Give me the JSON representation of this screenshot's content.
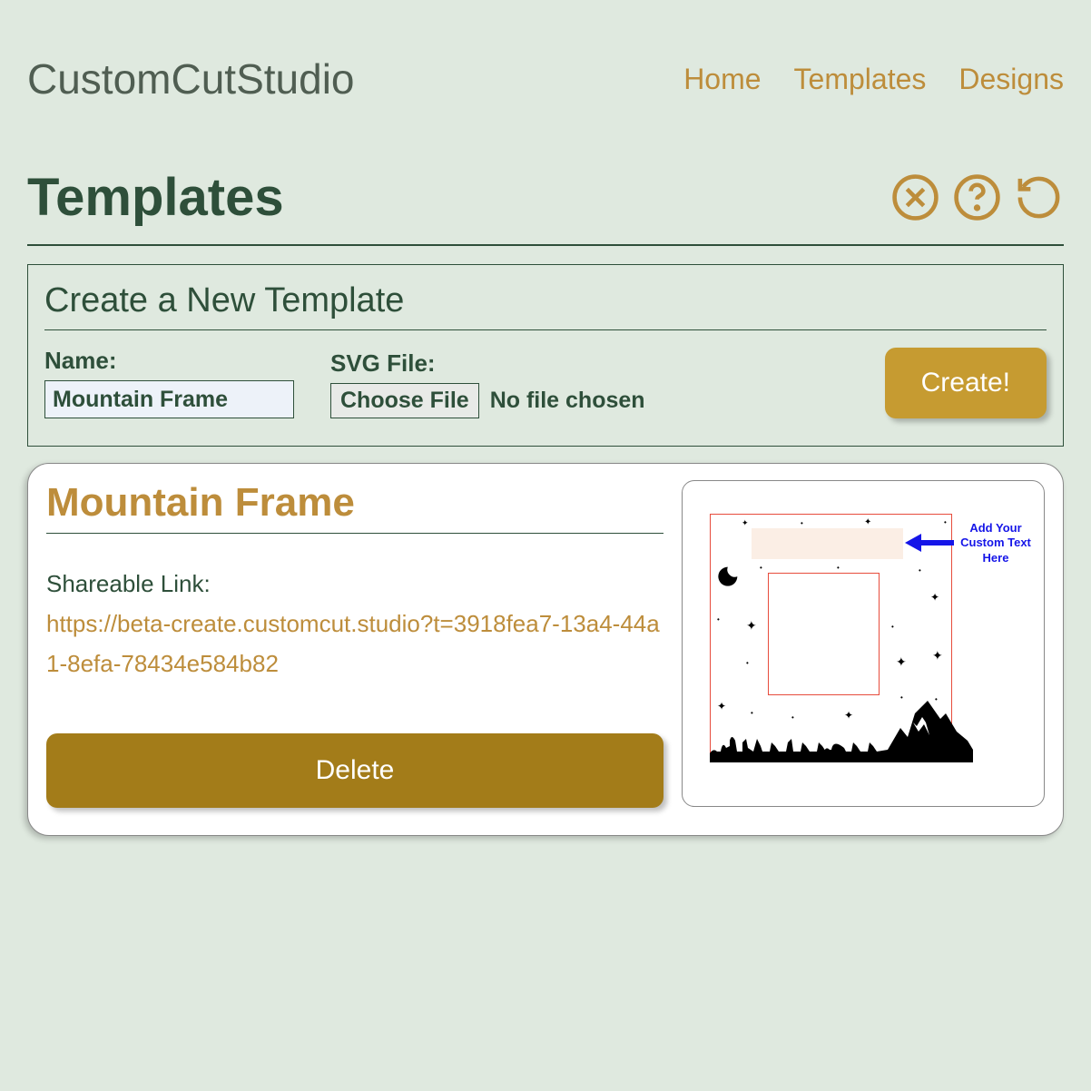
{
  "logo": "CustomCutStudio",
  "nav": {
    "home": "Home",
    "templates": "Templates",
    "designs": "Designs"
  },
  "page": {
    "title": "Templates"
  },
  "create": {
    "panel_title": "Create a New Template",
    "name_label": "Name:",
    "name_value": "Mountain Frame",
    "file_label": "SVG File:",
    "choose_file": "Choose File",
    "file_status": "No file chosen",
    "submit": "Create!"
  },
  "template": {
    "name": "Mountain Frame",
    "share_label": "Shareable Link:",
    "share_url": "https://beta-create.customcut.studio?t=3918fea7-13a4-44a1-8efa-78434e584b82",
    "delete": "Delete",
    "callout": "Add Your Custom Text Here"
  }
}
